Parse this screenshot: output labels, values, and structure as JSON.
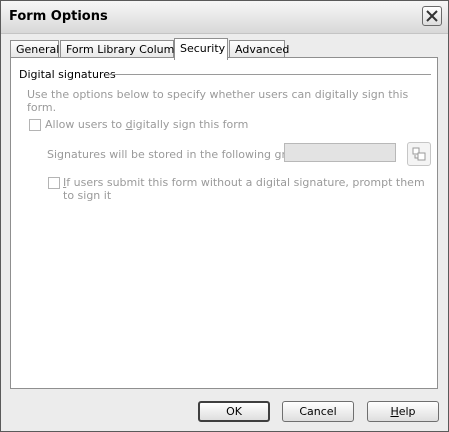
{
  "window": {
    "title": "Form Options"
  },
  "tabs": [
    {
      "label": "General"
    },
    {
      "label": "Form Library Columns"
    },
    {
      "label": "Security"
    },
    {
      "label": "Advanced"
    }
  ],
  "active_tab": "Security",
  "section": {
    "title": "Digital signatures",
    "description": "Use the options below to specify whether users can digitally sign this form."
  },
  "options": {
    "allow_sign": {
      "prefix": "Allow users to ",
      "underlined": "d",
      "suffix": "igitally sign this form",
      "checked": false
    },
    "group_label": "Signatures will be stored in the following group:",
    "group_value": "",
    "prompt_sign": {
      "underlined": "I",
      "suffix": "f users submit this form without a digital signature, prompt them to sign it",
      "checked": false
    }
  },
  "buttons": {
    "ok": "OK",
    "cancel": "Cancel",
    "help": {
      "underlined": "H",
      "suffix": "elp"
    }
  },
  "icons": {
    "close": "close-icon",
    "browse": "browse-group-icon"
  }
}
